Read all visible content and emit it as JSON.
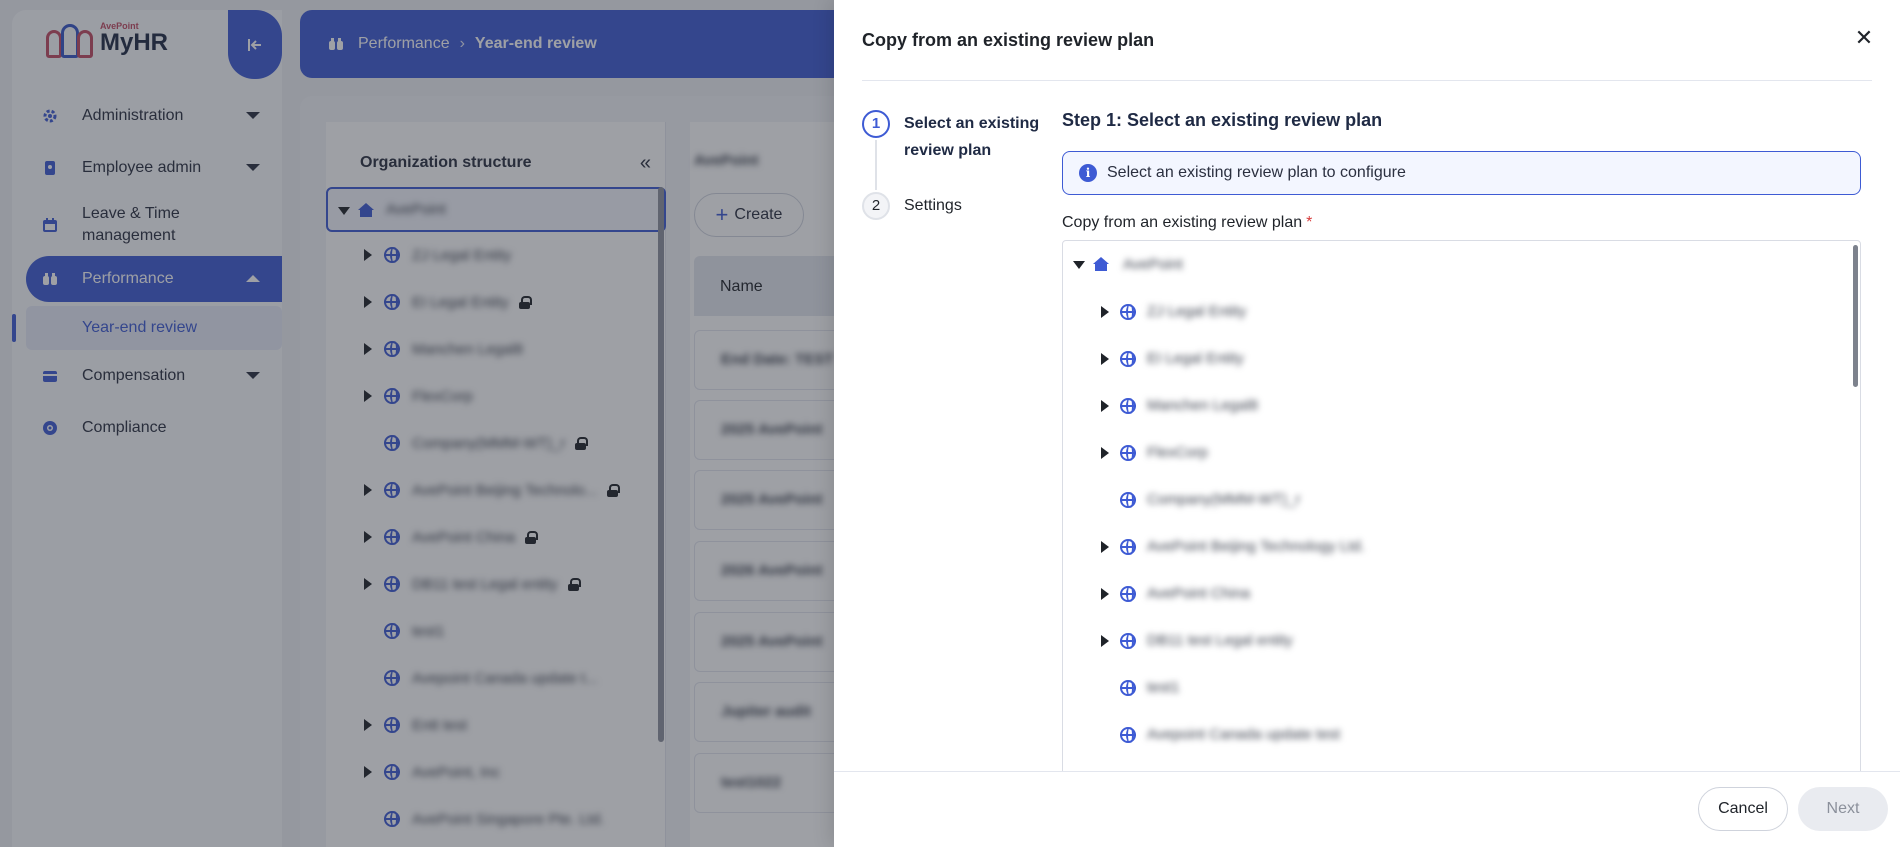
{
  "app": {
    "logo_sub": "AvePoint",
    "logo_main": "MyHR"
  },
  "sidebar": {
    "items": [
      {
        "label": "Administration",
        "icon": "gear-icon"
      },
      {
        "label": "Employee admin",
        "icon": "badge-icon"
      },
      {
        "label": "Leave & Time management",
        "icon": "calendar-icon"
      },
      {
        "label": "Performance",
        "icon": "binoculars-icon"
      },
      {
        "label": "Compensation",
        "icon": "wallet-icon"
      },
      {
        "label": "Compliance",
        "icon": "shield-icon"
      }
    ],
    "sub_item": "Year-end review"
  },
  "breadcrumb": {
    "section": "Performance",
    "current": "Year-end review"
  },
  "org_panel": {
    "title": "Organization structure",
    "root": "AvePoint",
    "items": [
      "ZJ Legal Entity",
      "EI Legal Entity",
      "Manchen Legal8",
      "FlexCorp",
      "Company(MMM-WT)_r",
      "AvePoint Beijing Technolo...",
      "AvePoint China",
      "DB11 test Legal entity",
      "test1",
      "Avepoint Canada update t...",
      "Entt test",
      "AvePoint, Inc",
      "AvePoint Singapore Pte. Ltd."
    ]
  },
  "list": {
    "heading": "AvePoint",
    "create_label": "Create",
    "column_name": "Name",
    "rows": [
      "End Date: TEST",
      "2025 AvePoint",
      "2025 AvePoint",
      "2026 AvePoint",
      "2025 AvePoint",
      "Jupiter audit",
      "test1022"
    ]
  },
  "dialog": {
    "title": "Copy from an existing review plan",
    "close_icon": "close-icon",
    "steps": [
      {
        "number": "1",
        "label": "Select an existing review plan"
      },
      {
        "number": "2",
        "label": "Settings"
      }
    ],
    "step_heading": "Step 1: Select an existing review plan",
    "info_text": "Select an existing review plan to configure",
    "field_label": "Copy from an existing review plan",
    "required_mark": "*",
    "tree": {
      "root": "AvePoint",
      "children": [
        {
          "label": "ZJ Legal Entity",
          "expandable": true
        },
        {
          "label": "EI Legal Entity",
          "expandable": true
        },
        {
          "label": "Manchen Legal8",
          "expandable": true
        },
        {
          "label": "FlexCorp",
          "expandable": true
        },
        {
          "label": "Company(MMM-WT)_r",
          "expandable": false
        },
        {
          "label": "AvePoint Beijing Technology Ltd.",
          "expandable": true
        },
        {
          "label": "AvePoint China",
          "expandable": true
        },
        {
          "label": "DB11 test Legal entity",
          "expandable": true
        },
        {
          "label": "test1",
          "expandable": false
        },
        {
          "label": "Avepoint Canada update test",
          "expandable": false
        }
      ]
    },
    "cancel_label": "Cancel",
    "next_label": "Next"
  },
  "colors": {
    "accent": "#3e5bd4",
    "brand_red": "#c24b63",
    "required": "#d63a3a"
  }
}
